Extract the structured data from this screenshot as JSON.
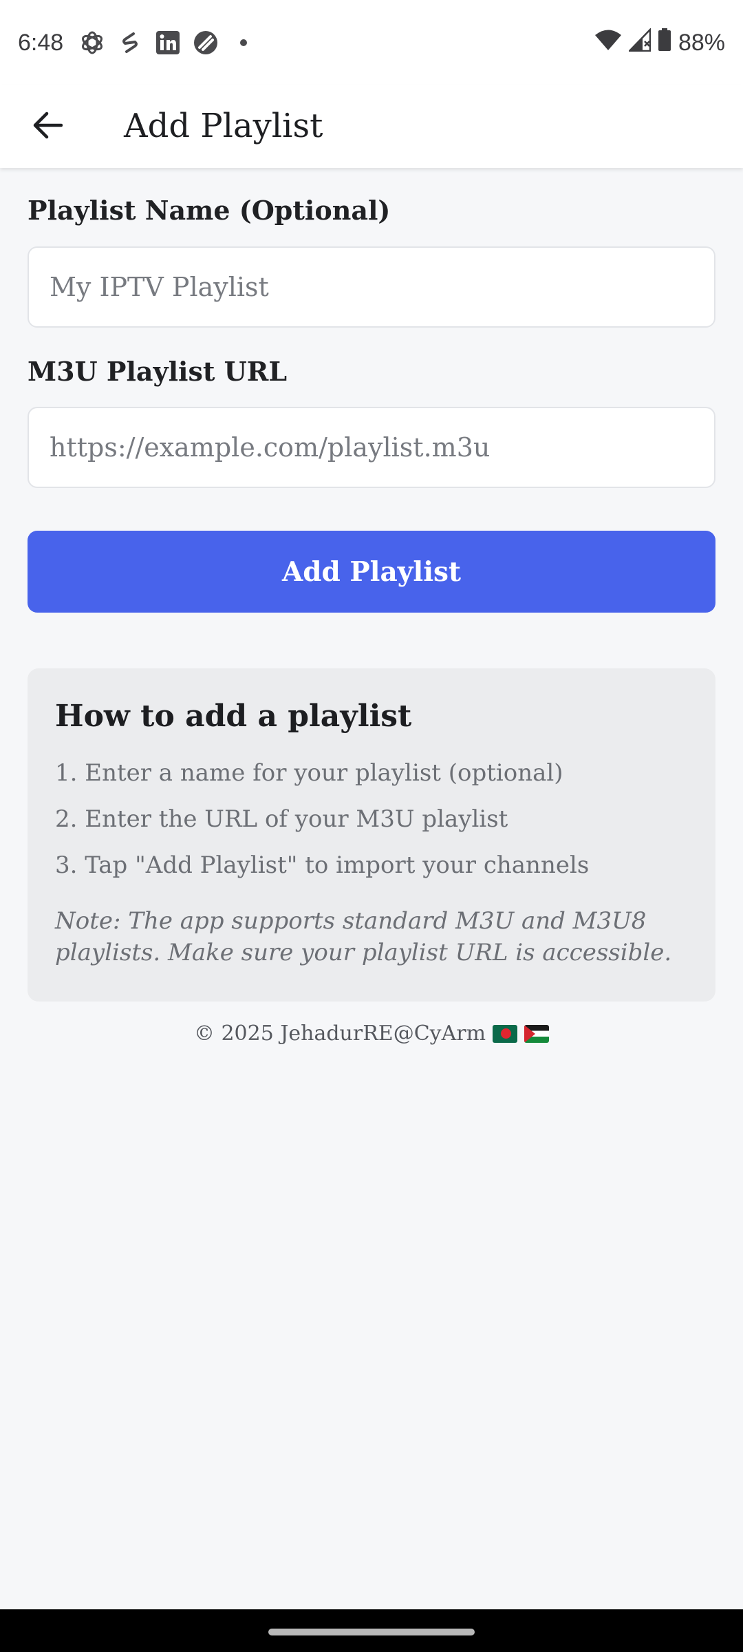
{
  "status_bar": {
    "time": "6:48",
    "notification_icons": [
      "openai-icon",
      "swirl-app-icon",
      "linkedin-icon",
      "brand-app-icon",
      "dot-icon"
    ],
    "battery_percent": "88%",
    "system_icons": [
      "wifi-icon",
      "cell-signal-icon",
      "battery-icon"
    ]
  },
  "app_bar": {
    "back_icon": "arrow-left-icon",
    "title": "Add Playlist"
  },
  "form": {
    "name_label": "Playlist Name (Optional)",
    "name_placeholder": "My IPTV Playlist",
    "name_value": "",
    "url_label": "M3U Playlist URL",
    "url_placeholder": "https://example.com/playlist.m3u",
    "url_value": "",
    "submit_label": "Add Playlist"
  },
  "instructions": {
    "title": "How to add a playlist",
    "steps": [
      "1. Enter a name for your playlist (optional)",
      "2. Enter the URL of your M3U playlist",
      "3. Tap \"Add Playlist\" to import your channels"
    ],
    "note": "Note: The app supports standard M3U and M3U8 playlists. Make sure your playlist URL is accessible."
  },
  "footer": {
    "text": "© 2025 JehadurRE@CyArm",
    "flags": [
      "bangladesh-flag",
      "palestine-flag"
    ]
  },
  "colors": {
    "primary": "#4863eb",
    "background": "#f6f7f9",
    "card": "#ebecee",
    "input_border": "#e2e4e8"
  }
}
